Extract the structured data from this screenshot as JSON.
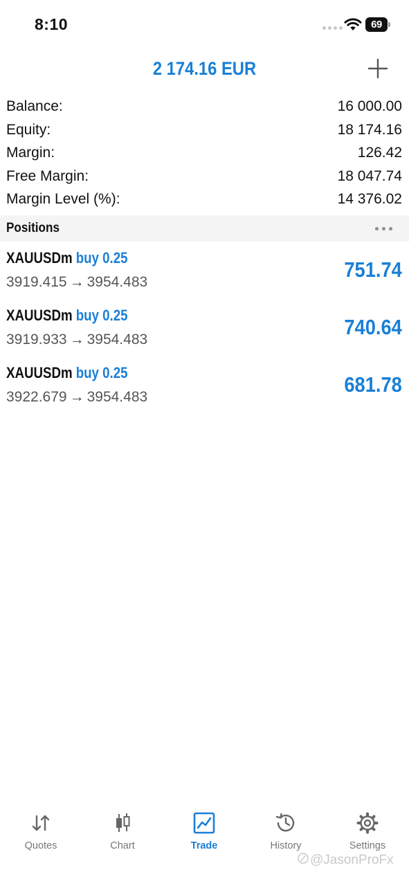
{
  "status_bar": {
    "time": "8:10",
    "battery": "69"
  },
  "header": {
    "title": "2 174.16 EUR"
  },
  "summary": [
    {
      "label": "Balance:",
      "value": "16 000.00"
    },
    {
      "label": "Equity:",
      "value": "18 174.16"
    },
    {
      "label": "Margin:",
      "value": "126.42"
    },
    {
      "label": "Free Margin:",
      "value": "18 047.74"
    },
    {
      "label": "Margin Level (%):",
      "value": "14 376.02"
    }
  ],
  "positions_section": {
    "title": "Positions"
  },
  "positions": [
    {
      "symbol": "XAUUSDm",
      "type": "buy 0.25",
      "open_price": "3919.415",
      "arrow": "→",
      "current_price": "3954.483",
      "profit": "751.74"
    },
    {
      "symbol": "XAUUSDm",
      "type": "buy 0.25",
      "open_price": "3919.933",
      "arrow": "→",
      "current_price": "3954.483",
      "profit": "740.64"
    },
    {
      "symbol": "XAUUSDm",
      "type": "buy 0.25",
      "open_price": "3922.679",
      "arrow": "→",
      "current_price": "3954.483",
      "profit": "681.78"
    }
  ],
  "tab_bar": {
    "tabs": [
      {
        "label": "Quotes",
        "icon": "quotes-arrows-icon"
      },
      {
        "label": "Chart",
        "icon": "candlestick-icon"
      },
      {
        "label": "Trade",
        "icon": "trade-chart-icon",
        "active": true
      },
      {
        "label": "History",
        "icon": "history-clock-icon"
      },
      {
        "label": "Settings",
        "icon": "gear-icon"
      }
    ]
  },
  "watermark": {
    "text": "@JasonProFx"
  },
  "colors": {
    "accent": "#1a7fd6",
    "section_bg": "#f4f4f4",
    "inactive_tab": "#777777"
  }
}
